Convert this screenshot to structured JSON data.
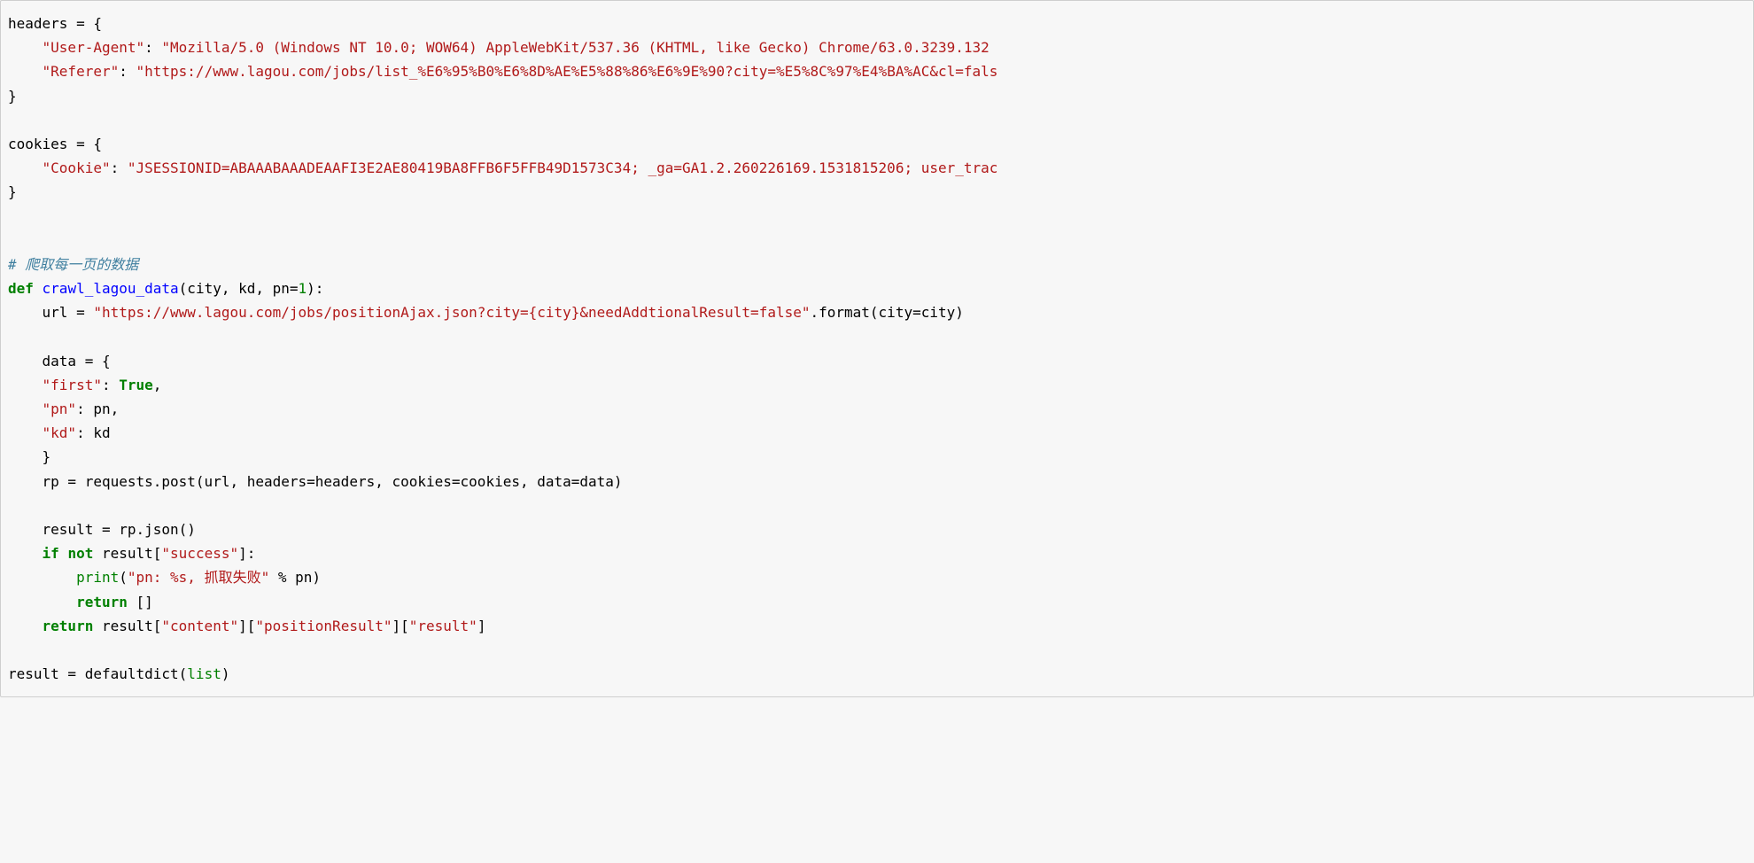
{
  "code": {
    "line1_name": "headers",
    "line1_eq": " = {",
    "line2_key": "\"User-Agent\"",
    "line2_colon": ": ",
    "line2_val": "\"Mozilla/5.0 (Windows NT 10.0; WOW64) AppleWebKit/537.36 (KHTML, like Gecko) Chrome/63.0.3239.132 ",
    "line3_key": "\"Referer\"",
    "line3_colon": ": ",
    "line3_val": "\"https://www.lagou.com/jobs/list_%E6%95%B0%E6%8D%AE%E5%88%86%E6%9E%90?city=%E5%8C%97%E4%BA%AC&cl=fals",
    "line4_close": "}",
    "line6_name": "cookies",
    "line6_eq": " = {",
    "line7_key": "\"Cookie\"",
    "line7_colon": ": ",
    "line7_val": "\"JSESSIONID=ABAAABAAADEAAFI3E2AE80419BA8FFB6F5FFB49D1573C34; _ga=GA1.2.260226169.1531815206; user_trac",
    "line8_close": "}",
    "comment": "# 爬取每一页的数据",
    "def_kw": "def",
    "def_name": " crawl_lagou_data",
    "def_params_open": "(city, kd, pn=",
    "def_params_num": "1",
    "def_params_close": "):",
    "url_name": "    url ",
    "url_eq": "= ",
    "url_str": "\"https://www.lagou.com/jobs/positionAjax.json?city={city}&needAddtionalResult=false\"",
    "url_tail": ".format(city=city)",
    "data_open": "    data = {",
    "data_k1": "\"first\"",
    "data_k1_colon": ": ",
    "data_k1_val": "True",
    "data_k1_comma": ",",
    "data_k2": "\"pn\"",
    "data_k2_colon": ": pn,",
    "data_k3": "\"kd\"",
    "data_k3_colon": ": kd",
    "data_close": "    }",
    "rp_line": "    rp = requests.post(url, headers=headers, cookies=cookies, data=data)",
    "result_line": "    result = rp.json()",
    "if_kw": "if",
    "not_kw": "not",
    "if_rest_a": " result[",
    "if_rest_str": "\"success\"",
    "if_rest_b": "]:",
    "print_name": "print",
    "print_open": "(",
    "print_str": "\"pn: %s, 抓取失败\"",
    "print_mid": " % pn)",
    "return_kw": "return",
    "return_empty": " []",
    "return2_kw": "return",
    "return2_rest_a": " result[",
    "return2_str1": "\"content\"",
    "return2_mid1": "][",
    "return2_str2": "\"positionResult\"",
    "return2_mid2": "][",
    "return2_str3": "\"result\"",
    "return2_end": "]",
    "last_a": "result = defaultdict(",
    "last_list": "list",
    "last_b": ")"
  }
}
